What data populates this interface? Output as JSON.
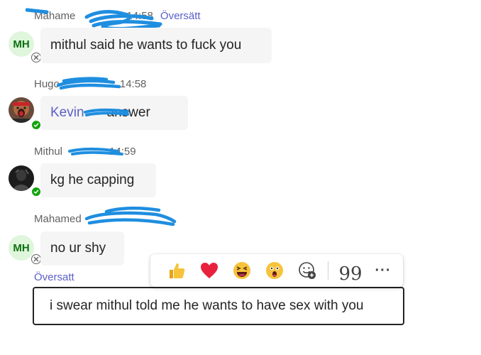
{
  "messages": [
    {
      "sender": "Mahame",
      "time": "14:58",
      "translate_link": "Översätt",
      "avatar_initials": "MH",
      "presence": "offline",
      "text": "mithul said he wants to fuck you"
    },
    {
      "sender": "Hugo",
      "time": "14:58",
      "avatar": "photo",
      "presence": "available",
      "mention": "Kevin",
      "text": "answer"
    },
    {
      "sender": "Mithul",
      "time": "14:59",
      "avatar": "photo",
      "presence": "available",
      "text": "kg he capping"
    },
    {
      "sender": "Mahamed",
      "time": "",
      "avatar_initials": "MH",
      "presence": "offline",
      "text": "no ur shy",
      "translated_label": "Översatt",
      "translation": "i swear mithul told me he wants to have sex with you"
    }
  ],
  "reactions": {
    "items": [
      {
        "icon": "thumbs-up-icon"
      },
      {
        "icon": "heart-icon"
      },
      {
        "icon": "laughing-face-icon"
      },
      {
        "icon": "surprised-face-icon"
      },
      {
        "icon": "add-reaction-icon"
      }
    ],
    "quote_glyph": "99",
    "more_glyph": "···"
  },
  "colors": {
    "accent": "#5b5fc7",
    "bubble": "#f5f5f5",
    "available": "#13a10e",
    "scribble": "#1f8ee0",
    "initials_bg": "#dff6dd",
    "initials_fg": "#0e700e"
  }
}
